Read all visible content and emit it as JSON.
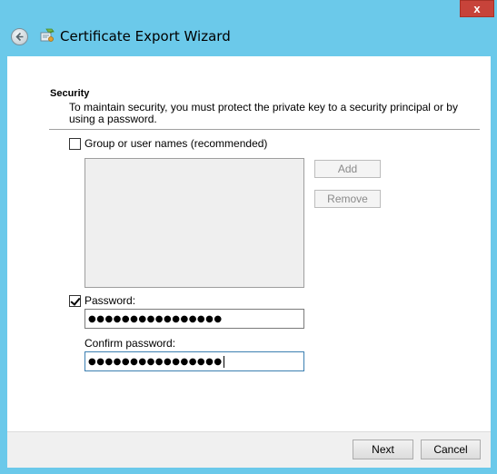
{
  "window": {
    "title": "Certificate Export Wizard",
    "close_glyph": "x",
    "accent_color": "#6bc9ea"
  },
  "icons": {
    "back": "back-arrow-icon",
    "wizard": "certificate-icon"
  },
  "section": {
    "heading": "Security",
    "description": "To maintain security, you must protect the private key to a security principal or by using a password."
  },
  "group_option": {
    "label": "Group or user names (recommended)",
    "checked": false
  },
  "principal_list": {
    "items": []
  },
  "buttons": {
    "add": "Add",
    "remove": "Remove",
    "next": "Next",
    "cancel": "Cancel"
  },
  "password_option": {
    "label": "Password:",
    "checked": true,
    "value": "●●●●●●●●●●●●●●●●"
  },
  "confirm_password": {
    "label": "Confirm password:",
    "value": "●●●●●●●●●●●●●●●●"
  }
}
